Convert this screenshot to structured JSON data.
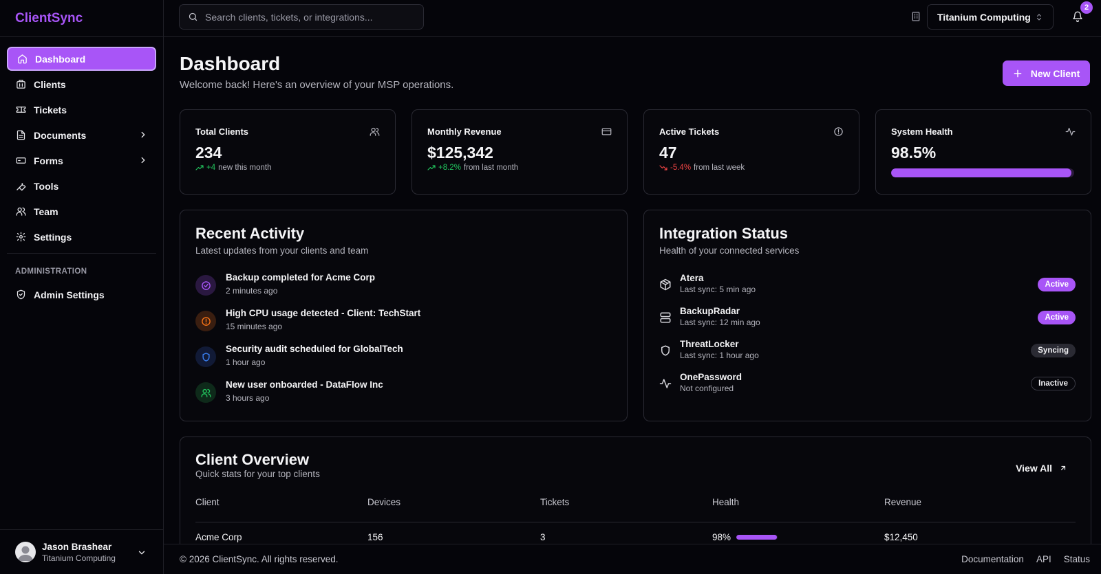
{
  "app": {
    "name": "ClientSync"
  },
  "sidebar": {
    "items": [
      {
        "label": "Dashboard",
        "icon": "home-icon"
      },
      {
        "label": "Clients",
        "icon": "building-icon"
      },
      {
        "label": "Tickets",
        "icon": "ticket-icon"
      },
      {
        "label": "Documents",
        "icon": "file-icon"
      },
      {
        "label": "Forms",
        "icon": "form-icon"
      },
      {
        "label": "Tools",
        "icon": "wrench-icon"
      },
      {
        "label": "Team",
        "icon": "users-icon"
      },
      {
        "label": "Settings",
        "icon": "gear-icon"
      }
    ],
    "admin_section": "ADMINISTRATION",
    "admin_items": [
      {
        "label": "Admin Settings",
        "icon": "shield-icon"
      }
    ],
    "user": {
      "name": "Jason Brashear",
      "org": "Titanium Computing"
    }
  },
  "topbar": {
    "search_placeholder": "Search clients, tickets, or integrations...",
    "org_selector": "Titanium Computing",
    "notification_count": "2"
  },
  "page": {
    "title": "Dashboard",
    "subtitle": "Welcome back! Here's an overview of your MSP operations.",
    "new_button": "New Client"
  },
  "stats": [
    {
      "title": "Total Clients",
      "value": "234",
      "delta": "+4",
      "delta_text": "new this month",
      "icon": "users-icon"
    },
    {
      "title": "Monthly Revenue",
      "value": "$125,342",
      "delta": "+8.2%",
      "delta_text": "from last month",
      "icon": "credit-card-icon"
    },
    {
      "title": "Active Tickets",
      "value": "47",
      "delta": "-5.4%",
      "delta_text": "from last week",
      "icon": "alert-circle-icon"
    },
    {
      "title": "System Health",
      "value": "98.5%",
      "level_percent": 98.5,
      "icon": "activity-icon"
    }
  ],
  "activity": {
    "title": "Recent Activity",
    "subtitle": "Latest updates from your clients and team",
    "items": [
      {
        "text": "Backup completed for Acme Corp",
        "time": "2 minutes ago",
        "icon": "check-circle-icon",
        "color": "#a855f7"
      },
      {
        "text": "High CPU usage detected - Client: TechStart",
        "time": "15 minutes ago",
        "icon": "alert-circle-icon",
        "color": "#f97316"
      },
      {
        "text": "Security audit scheduled for GlobalTech",
        "time": "1 hour ago",
        "icon": "shield-icon",
        "color": "#3b82f6"
      },
      {
        "text": "New user onboarded - DataFlow Inc",
        "time": "3 hours ago",
        "icon": "users-icon",
        "color": "#22c55e"
      }
    ]
  },
  "integrations": {
    "title": "Integration Status",
    "subtitle": "Health of your connected services",
    "items": [
      {
        "name": "Atera",
        "sync": "Last sync: 5 min ago",
        "status": "Active",
        "icon": "package-icon"
      },
      {
        "name": "BackupRadar",
        "sync": "Last sync: 12 min ago",
        "status": "Active",
        "icon": "server-icon"
      },
      {
        "name": "ThreatLocker",
        "sync": "Last sync: 1 hour ago",
        "status": "Syncing",
        "icon": "shield-icon"
      },
      {
        "name": "OnePassword",
        "sync": "Not configured",
        "status": "Inactive",
        "icon": "activity-icon"
      }
    ]
  },
  "client_overview": {
    "title": "Client Overview",
    "subtitle": "Quick stats for your top clients",
    "view_all": "View All",
    "columns": [
      "Client",
      "Devices",
      "Tickets",
      "Health",
      "Revenue"
    ],
    "rows": [
      {
        "client": "Acme Corp",
        "devices": "156",
        "tickets": "3",
        "health": "98%",
        "health_percent": 98,
        "revenue": "$12,450"
      }
    ]
  },
  "footer": {
    "copyright": "© 2026 ClientSync. All rights reserved.",
    "links": [
      "Documentation",
      "API",
      "Status"
    ]
  },
  "colors": {
    "accent": "#a855f7",
    "up": "#22c55e",
    "down": "#ef4444",
    "background": "#05050a"
  }
}
